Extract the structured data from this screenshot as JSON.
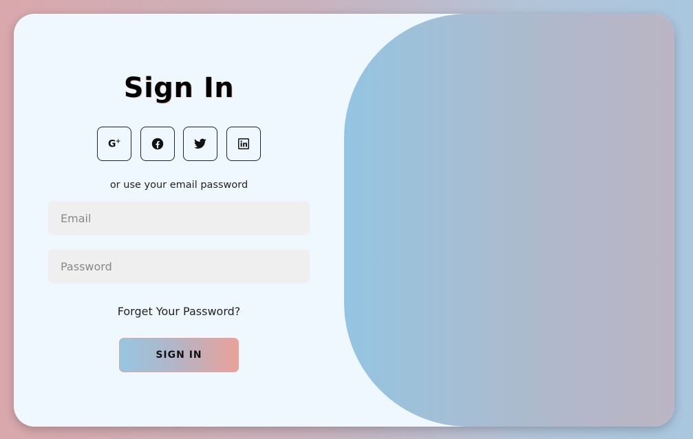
{
  "signin": {
    "title": "Sign In",
    "social": [
      {
        "name": "google-plus",
        "label": "G+"
      },
      {
        "name": "facebook",
        "label": ""
      },
      {
        "name": "twitter",
        "label": ""
      },
      {
        "name": "linkedin",
        "label": ""
      }
    ],
    "hint": "or use your email password",
    "email_placeholder": "Email",
    "password_placeholder": "Password",
    "forgot_label": "Forget Your Password?",
    "submit_label": "SIGN IN"
  },
  "colors": {
    "card_bg": "#f0f8ff",
    "field_bg": "#efefef",
    "accent_blue": "#96c6e2",
    "accent_pink": "#eaa199"
  }
}
